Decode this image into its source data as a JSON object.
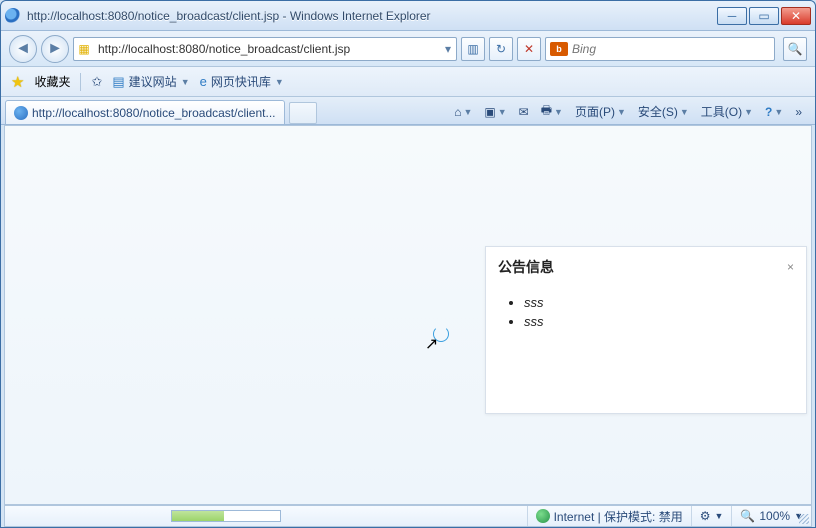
{
  "title": "http://localhost:8080/notice_broadcast/client.jsp - Windows Internet Explorer",
  "address": {
    "url_display_pre": "http://",
    "url_display_host": "localhost",
    "url_display_rest": ":8080/notice_broadcast/client.jsp"
  },
  "search": {
    "placeholder": "Bing"
  },
  "favorites": {
    "label": "收藏夹",
    "suggested": "建议网站",
    "gallery": "网页快讯库"
  },
  "tab": {
    "title": "http://localhost:8080/notice_broadcast/client..."
  },
  "commands": {
    "page": "页面(P)",
    "safety": "安全(S)",
    "tools": "工具(O)"
  },
  "notice": {
    "title": "公告信息",
    "close": "×",
    "items": [
      "sss",
      "sss"
    ]
  },
  "status": {
    "zone": "Internet | 保护模式: 禁用",
    "zoom": "100%"
  }
}
